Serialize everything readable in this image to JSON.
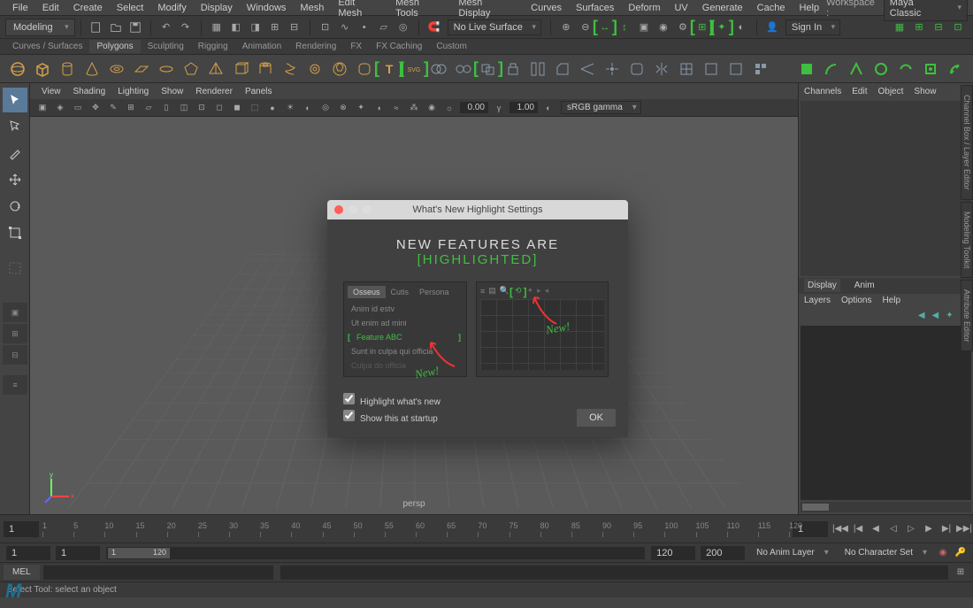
{
  "menubar": {
    "items": [
      "File",
      "Edit",
      "Create",
      "Select",
      "Modify",
      "Display",
      "Windows",
      "Mesh",
      "Edit Mesh",
      "Mesh Tools",
      "Mesh Display",
      "Curves",
      "Surfaces",
      "Deform",
      "UV",
      "Generate",
      "Cache",
      "Help"
    ],
    "workspace_label": "Workspace :",
    "workspace_value": "Maya Classic"
  },
  "mode_selector": "Modeling",
  "live_surface": "No Live Surface",
  "sign_in": "Sign In",
  "shelf_tabs": [
    "Curves / Surfaces",
    "Polygons",
    "Sculpting",
    "Rigging",
    "Animation",
    "Rendering",
    "FX",
    "FX Caching",
    "Custom"
  ],
  "shelf_active": "Polygons",
  "viewport_menu": [
    "View",
    "Shading",
    "Lighting",
    "Show",
    "Renderer",
    "Panels"
  ],
  "vp_num1": "0.00",
  "vp_num2": "1.00",
  "vp_gamma": "sRGB gamma",
  "persp": "persp",
  "right_panel": {
    "tabs": [
      "Channels",
      "Edit",
      "Object",
      "Show"
    ],
    "layer_tabs": [
      "Display",
      "Anim"
    ],
    "layer_menu": [
      "Layers",
      "Options",
      "Help"
    ]
  },
  "vert_tabs": [
    "Channel Box / Layer Editor",
    "Modeling Toolkit",
    "Attribute Editor"
  ],
  "timeline": {
    "start": "1",
    "ticks": [
      "1",
      "5",
      "10",
      "15",
      "20",
      "25",
      "30",
      "35",
      "40",
      "45",
      "50",
      "55",
      "60",
      "65",
      "70",
      "75",
      "80",
      "85",
      "90",
      "95",
      "100",
      "105",
      "110",
      "115",
      "120"
    ],
    "end": "1"
  },
  "range": {
    "a": "1",
    "b": "1",
    "c": "1",
    "d": "120",
    "e": "120",
    "f": "200",
    "anim_layer": "No Anim Layer",
    "char_set": "No Character Set"
  },
  "mel": "MEL",
  "status": "Select Tool: select an object",
  "dialog": {
    "title": "What's New Highlight Settings",
    "heading_pre": "NEW  FEATURES  ARE ",
    "heading_hl": "[HIGHLIGHTED]",
    "left_tabs": [
      "Osseus",
      "Cutis",
      "Persona"
    ],
    "list": [
      "Anim id estv",
      "Ut enim ad mini",
      "Feature ABC",
      "Sunt in culpa qui officia",
      "Culpa do officia"
    ],
    "new_label": "New!",
    "check1": "Highlight what's new",
    "check2": "Show this at startup",
    "ok": "OK"
  }
}
